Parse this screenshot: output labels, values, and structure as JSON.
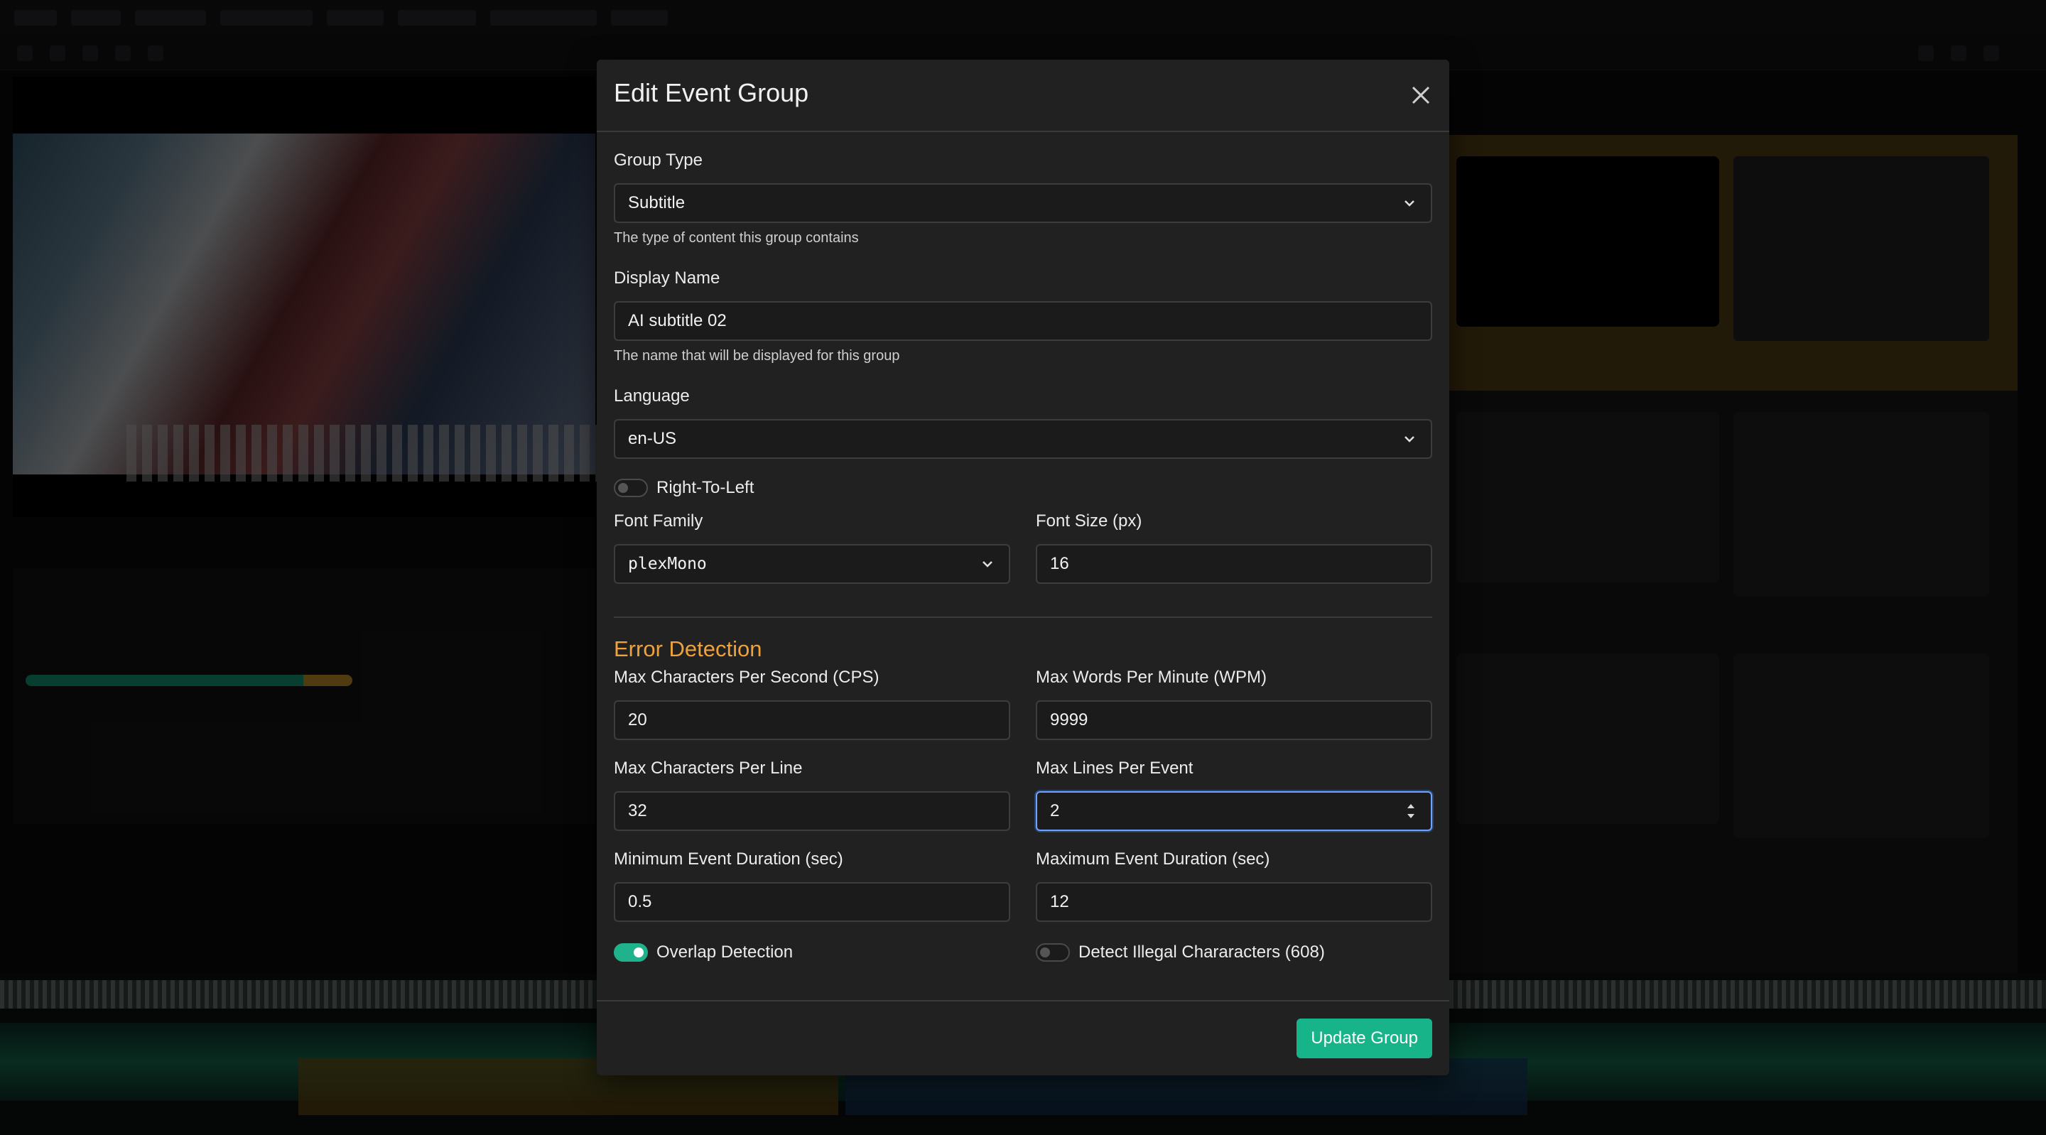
{
  "modal": {
    "title": "Edit Event Group",
    "group_type": {
      "label": "Group Type",
      "value": "Subtitle",
      "help": "The type of content this group contains"
    },
    "display_name": {
      "label": "Display Name",
      "value": "AI subtitle 02",
      "help": "The name that will be displayed for this group"
    },
    "language": {
      "label": "Language",
      "value": "en-US"
    },
    "rtl": {
      "label": "Right-To-Left",
      "enabled": false
    },
    "font_family": {
      "label": "Font Family",
      "value": "plexMono"
    },
    "font_size": {
      "label": "Font Size (px)",
      "value": "16"
    },
    "error_detection": {
      "title": "Error Detection",
      "max_cps": {
        "label": "Max Characters Per Second (CPS)",
        "value": "20"
      },
      "max_wpm": {
        "label": "Max Words Per Minute (WPM)",
        "value": "9999"
      },
      "max_chars_per_line": {
        "label": "Max Characters Per Line",
        "value": "32"
      },
      "max_lines_per_event": {
        "label": "Max Lines Per Event",
        "value": "2"
      },
      "min_duration": {
        "label": "Minimum Event Duration (sec)",
        "value": "0.5"
      },
      "max_duration": {
        "label": "Maximum Event Duration (sec)",
        "value": "12"
      },
      "overlap_detection": {
        "label": "Overlap Detection",
        "enabled": true
      },
      "illegal_chars": {
        "label": "Detect Illegal Chararacters (608)",
        "enabled": false
      }
    },
    "update_button": "Update Group"
  },
  "colors": {
    "accent": "#17b489",
    "section_title": "#f0a13a",
    "modal_bg": "#212121",
    "focus_border": "#6ea3ff"
  }
}
